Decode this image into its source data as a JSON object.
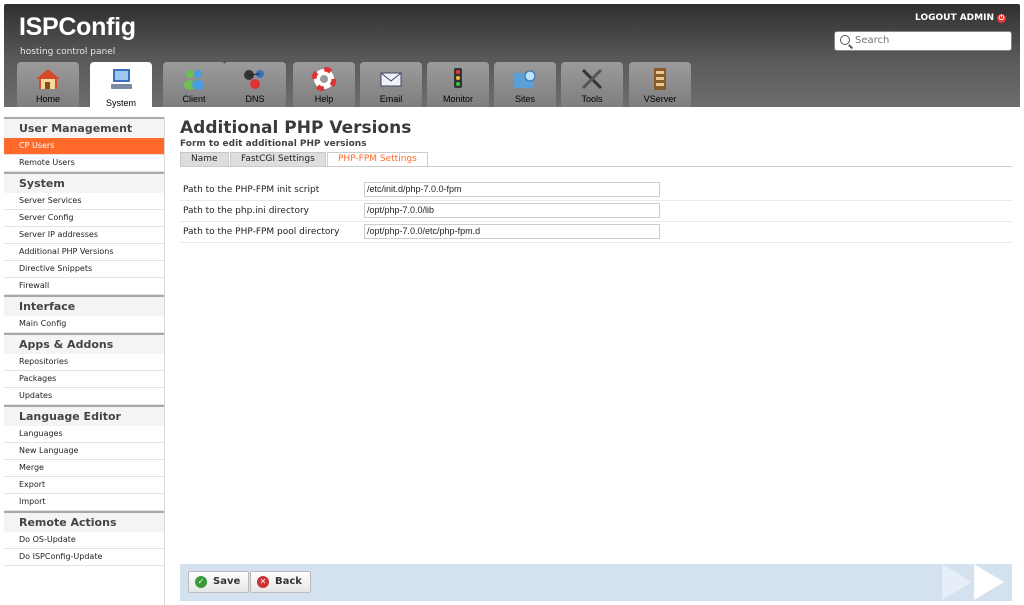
{
  "header": {
    "title": "ISPConfig",
    "subtitle": "hosting control panel",
    "logout_label": "LOGOUT ADMIN",
    "search_placeholder": "Search"
  },
  "tabs": [
    {
      "label": "Home",
      "icon": "home-icon"
    },
    {
      "label": "System",
      "icon": "computer-icon",
      "active": true
    },
    {
      "label": "Client",
      "icon": "users-icon"
    },
    {
      "label": "DNS",
      "icon": "dns-icon"
    },
    {
      "label": "Help",
      "icon": "lifebuoy-icon"
    },
    {
      "label": "Email",
      "icon": "envelope-icon"
    },
    {
      "label": "Monitor",
      "icon": "traffic-light-icon"
    },
    {
      "label": "Sites",
      "icon": "folder-globe-icon"
    },
    {
      "label": "Tools",
      "icon": "tools-icon"
    },
    {
      "label": "VServer",
      "icon": "server-icon"
    }
  ],
  "sidebar": {
    "sections": [
      {
        "title": "User Management",
        "items": [
          "CP Users",
          "Remote Users"
        ]
      },
      {
        "title": "System",
        "items": [
          "Server Services",
          "Server Config",
          "Server IP addresses",
          "Additional PHP Versions",
          "Directive Snippets",
          "Firewall"
        ]
      },
      {
        "title": "Interface",
        "items": [
          "Main Config"
        ]
      },
      {
        "title": "Apps & Addons",
        "items": [
          "Repositories",
          "Packages",
          "Updates"
        ]
      },
      {
        "title": "Language Editor",
        "items": [
          "Languages",
          "New Language",
          "Merge",
          "Export",
          "Import"
        ]
      },
      {
        "title": "Remote Actions",
        "items": [
          "Do OS-Update",
          "Do ISPConfig-Update"
        ]
      }
    ],
    "active_item": "CP Users"
  },
  "main": {
    "title": "Additional PHP Versions",
    "subtitle": "Form to edit additional PHP versions",
    "form_tabs": [
      "Name",
      "FastCGI Settings",
      "PHP-FPM Settings"
    ],
    "active_form_tab": "PHP-FPM Settings",
    "fields": [
      {
        "label": "Path to the PHP-FPM init script",
        "value": "/etc/init.d/php-7.0.0-fpm"
      },
      {
        "label": "Path to the php.ini directory",
        "value": "/opt/php-7.0.0/lib"
      },
      {
        "label": "Path to the PHP-FPM pool directory",
        "value": "/opt/php-7.0.0/etc/php-fpm.d"
      }
    ]
  },
  "buttons": {
    "save_label": "Save",
    "back_label": "Back"
  },
  "colors": {
    "accent": "#ff6a2a",
    "header_bg": "#4a4a4a",
    "button_bar": "#d4e1ef"
  }
}
